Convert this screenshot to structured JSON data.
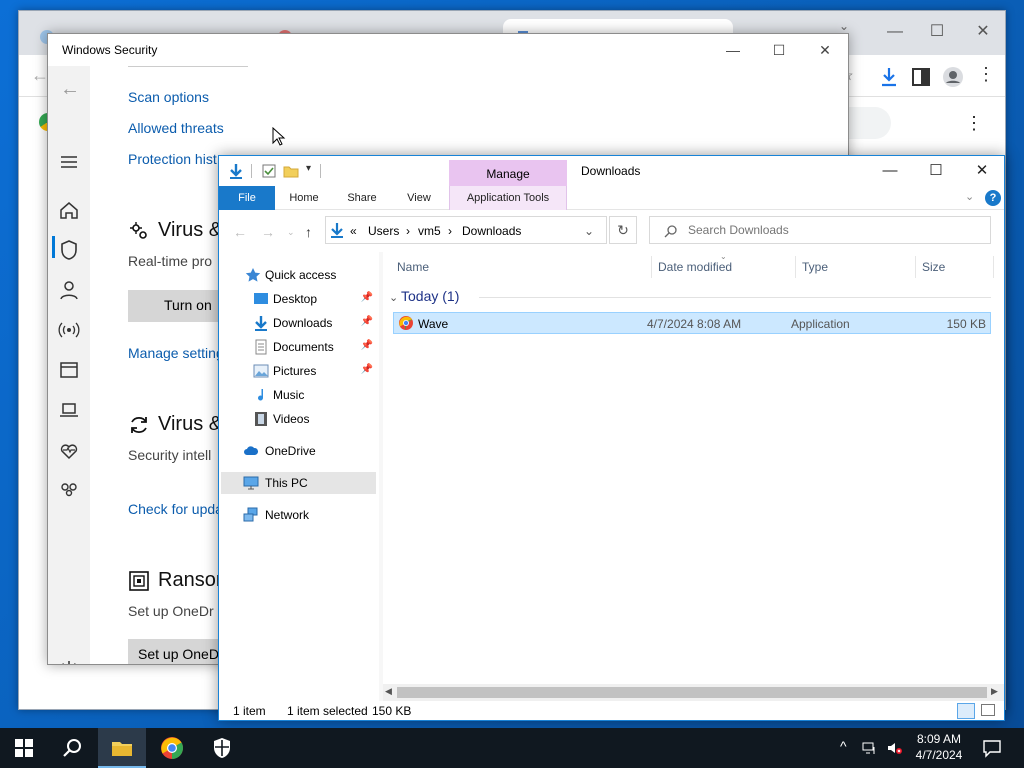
{
  "winsec": {
    "title": "Windows Security",
    "links": {
      "scan_options": "Scan options",
      "allowed_threats": "Allowed threats",
      "protection_history": "Protection hist",
      "manage_settings": "Manage setting",
      "check_updates": "Check for upda"
    },
    "sections": {
      "virus_settings_title": "Virus &",
      "virus_settings_sub": "Real-time pro",
      "turn_on": "Turn on",
      "virus_updates_title": "Virus &",
      "virus_updates_sub": "Security intell",
      "ransomware_title": "Ranson",
      "ransomware_sub": "Set up OneDr",
      "setup_onedrive": "Set up OneD"
    }
  },
  "explorer": {
    "title": "Downloads",
    "manage_label": "Manage",
    "ribbon_tabs": [
      "File",
      "Home",
      "Share",
      "View",
      "Application Tools"
    ],
    "address": {
      "prefix": "«",
      "parts": [
        "Users",
        "vm5",
        "Downloads"
      ]
    },
    "search_placeholder": "Search Downloads",
    "nav": {
      "quick_access": "Quick access",
      "desktop": "Desktop",
      "downloads": "Downloads",
      "documents": "Documents",
      "pictures": "Pictures",
      "music": "Music",
      "videos": "Videos",
      "onedrive": "OneDrive",
      "this_pc": "This PC",
      "network": "Network"
    },
    "columns": {
      "name": "Name",
      "date": "Date modified",
      "type": "Type",
      "size": "Size"
    },
    "group_label": "Today (1)",
    "file": {
      "name": "Wave",
      "date": "4/7/2024 8:08 AM",
      "type": "Application",
      "size": "150 KB"
    },
    "status": {
      "count": "1 item",
      "selected": "1 item selected",
      "size": "150 KB"
    }
  },
  "taskbar": {
    "time": "8:09 AM",
    "date": "4/7/2024"
  },
  "colors": {
    "accent": "#0078d7",
    "manage_tab": "#e9c4f0",
    "selection": "#cce8ff",
    "link": "#0b5cad"
  }
}
